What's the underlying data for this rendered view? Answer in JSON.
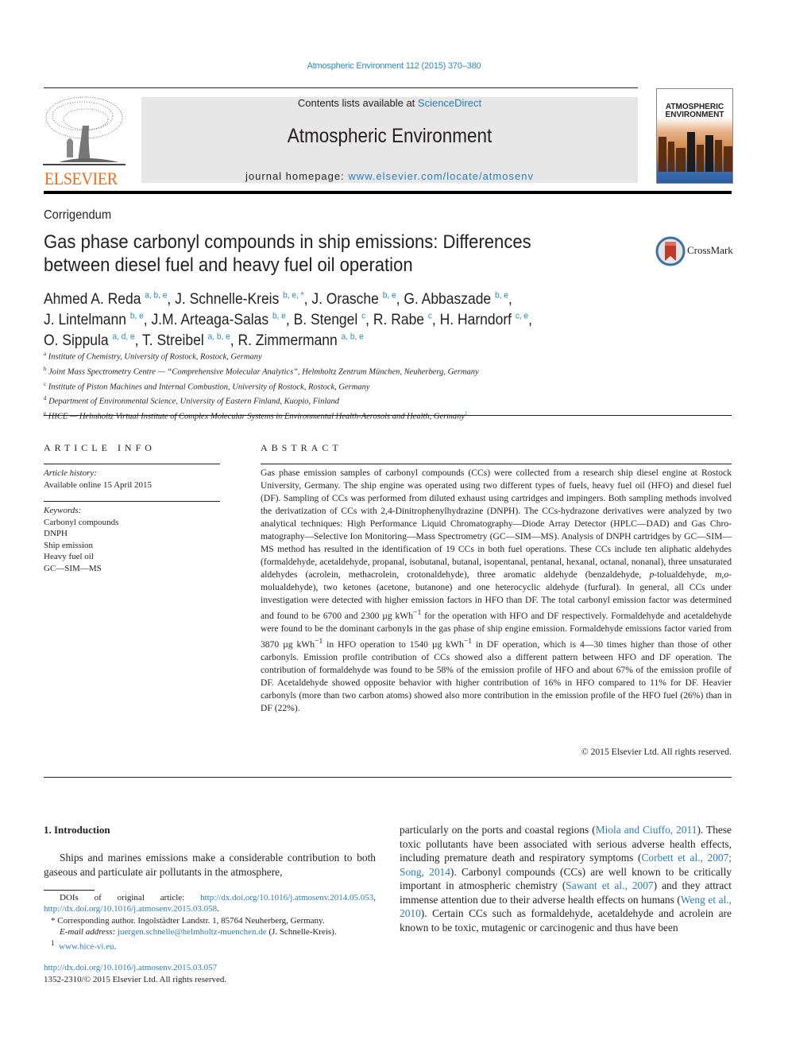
{
  "header": {
    "journal_reference": "Atmospheric Environment 112 (2015) 370–380",
    "contents_prefix": "Contents lists available at ",
    "contents_link": "ScienceDirect",
    "journal_title": "Atmospheric Environment",
    "homepage_prefix": "journal homepage: ",
    "homepage_link": "www.elsevier.com/locate/atmosenv",
    "publisher_logo_text": "ELSEVIER",
    "cover_title_line1": "ATMOSPHERIC",
    "cover_title_line2": "ENVIRONMENT",
    "brand_colors": {
      "link": "#2a7db8",
      "elsevier_orange": "#e9711c",
      "crossmark_red": "#c0392b"
    }
  },
  "article": {
    "type": "Corrigendum",
    "title_line1": "Gas phase carbonyl compounds in ship emissions: Differences",
    "title_line2": "between diesel fuel and heavy fuel oil operation",
    "crossmark_label": "CrossMark",
    "authors": [
      {
        "name": "Ahmed A. Reda",
        "aff": "a, b, e",
        "sep": ", "
      },
      {
        "name": "J. Schnelle-Kreis",
        "aff": "b, e, *",
        "sep": ", "
      },
      {
        "name": "J. Orasche",
        "aff": "b, e",
        "sep": ", "
      },
      {
        "name": "G. Abbaszade",
        "aff": "b, e",
        "sep": ","
      },
      {
        "name": "J. Lintelmann",
        "aff": "b, e",
        "sep": ", "
      },
      {
        "name": "J.M. Arteaga-Salas",
        "aff": "b, e",
        "sep": ", "
      },
      {
        "name": "B. Stengel",
        "aff": "c",
        "sep": ", "
      },
      {
        "name": "R. Rabe",
        "aff": "c",
        "sep": ", "
      },
      {
        "name": "H. Harndorf",
        "aff": "c, e",
        "sep": ","
      },
      {
        "name": "O. Sippula",
        "aff": "a, d, e",
        "sep": ", "
      },
      {
        "name": "T. Streibel",
        "aff": "a, b, e",
        "sep": ", "
      },
      {
        "name": "R. Zimmermann",
        "aff": "a, b, e",
        "sep": ""
      }
    ],
    "affiliations": [
      {
        "key": "a",
        "text": "Institute of Chemistry, University of Rostock, Rostock, Germany"
      },
      {
        "key": "b",
        "text": "Joint Mass Spectrometry Centre — “Comprehensive Molecular Analytics”, Helmholtz Zentrum München, Neuherberg, Germany"
      },
      {
        "key": "c",
        "text": "Institute of Piston Machines and Internal Combustion, University of Rostock, Rostock, Germany"
      },
      {
        "key": "d",
        "text": "Department of Environmental Science, University of Eastern Finland, Kuopio, Finland"
      },
      {
        "key": "e",
        "text": "HICE — Helmholtz Virtual Institute of Complex Molecular Systems in Environmental Health-Aerosols and Health, Germany",
        "note": "1"
      }
    ]
  },
  "article_info": {
    "heading": "ARTICLE INFO",
    "history_label": "Article history:",
    "history_value": "Available online 15 April 2015",
    "keywords_label": "Keywords:",
    "keywords": [
      "Carbonyl compounds",
      "DNPH",
      "Ship emission",
      "Heavy fuel oil",
      "GC—SIM—MS"
    ]
  },
  "abstract": {
    "heading": "ABSTRACT",
    "p1": "Gas phase emission samples of carbonyl compounds (CCs) were collected from a research ship diesel engine at Rostock University, Germany. The ship engine was operated using two different types of fuels, heavy fuel oil (HFO) and diesel fuel (DF). Sampling of CCs was performed from diluted exhaust using cartridges and impingers. Both sampling methods involved the derivatization of CCs with 2,4-Dinitrophenylhydrazine (DNPH). The CCs-hydrazone derivatives were analyzed by two analytical tech­niques: High Performance Liquid Chromatography—Diode Array Detector (HPLC—DAD) and Gas Chro­matography—Selective Ion Monitoring—Mass Spectrometry (GC—SIM—MS). Analysis of DNPH cartridges by GC—SIM—MS method has resulted in the identification of 19 CCs in both fuel operations. These CCs include ten aliphatic aldehydes (formaldehyde, acetaldehyde, propanal, isobutanal, butanal, isopentanal, pentanal, hexanal, octanal, nonanal), three unsaturated aldehydes (acrolein, methacrolein, crotonalde­hyde), three aromatic aldehyde (benzaldehyde, ",
    "p_italic_1": "p",
    "p2": "-tolualdehyde, ",
    "p_italic_2": "m,o",
    "p3": "-molualdehyde), two ketones (acetone, butanone) and one heterocyclic aldehyde (furfural). In general, all CCs under investigation were detected with higher emission factors in HFO than DF. The total carbonyl emission factor was determined and found to be 6700 and 2300 µg kWh",
    "p4": " for the operation with HFO and DF respectively. Formaldehyde and acetaldehyde were found to be the dominant carbonyls in the gas phase of ship engine emission. Formaldehyde emissions factor varied from 3870 µg kWh",
    "p5": " in HFO operation to 1540 µg kWh",
    "p6": " in DF operation, which is 4—30 times higher than those of other carbonyls. Emission profile contribution of CCs showed also a different pattern between HFO and DF operation. The contribution of formaldehyde was found to be 58% of the emission profile of HFO and about 67% of the emission profile of DF. Acetaldehyde showed opposite behavior with higher contribution of 16% in HFO compared to 11% for DF. Heavier carbonyls (more than two carbon atoms) showed also more contribution in the emission profile of the HFO fuel (26%) than in DF (22%).",
    "unit_exp": "−1",
    "copyright": "© 2015 Elsevier Ltd. All rights reserved."
  },
  "introduction": {
    "heading": "1.  Introduction",
    "left_text": "Ships and marines emissions make a considerable contribution to both gaseous and particulate air pollutants in the atmosphere,",
    "right_t1": "particularly on the ports and coastal regions (",
    "right_c1": "Miola and Ciuffo, 2011",
    "right_t2": "). These toxic pollutants have been associated with serious adverse health effects, including premature death and respiratory symptoms (",
    "right_c2": "Corbett et al., 2007; Song, 2014",
    "right_t3": "). Carbonyl compounds (CCs) are well known to be critically important in atmospheric chemistry (",
    "right_c3": "Sawant et al., 2007",
    "right_t4": ") and they attract immense attention due to their adverse health effects on humans (",
    "right_c4": "Weng et al., 2010",
    "right_t5": "). Certain CCs such as formaldehyde, acetaldehyde and acrolein are known to be toxic, mutagenic or carcinogenic and thus have been"
  },
  "footnotes": {
    "doi_prefix": "DOIs of original article: ",
    "doi_link1": "http://dx.doi.org/10.1016/j.atmosenv.2014.05.053",
    "doi_sep": ", ",
    "doi_link2": "http://dx.doi.org/10.1016/j.atmosenv.2015.03.058",
    "doi_end": ".",
    "corr_marker": "*",
    "corr_text": " Corresponding author. Ingolstädter Landstr. 1, 85764 Neuherberg, Germany.",
    "email_label": "E-mail address: ",
    "email": "juergen.schnelle@helmholtz-muenchen.de",
    "email_suffix": " (J. Schnelle-Kreis).",
    "note1_marker": "1",
    "note1_link": "www.hice-vi.eu",
    "note1_end": ".",
    "article_doi": "http://dx.doi.org/10.1016/j.atmosenv.2015.03.057",
    "issn_line": "1352-2310/© 2015 Elsevier Ltd. All rights reserved."
  }
}
